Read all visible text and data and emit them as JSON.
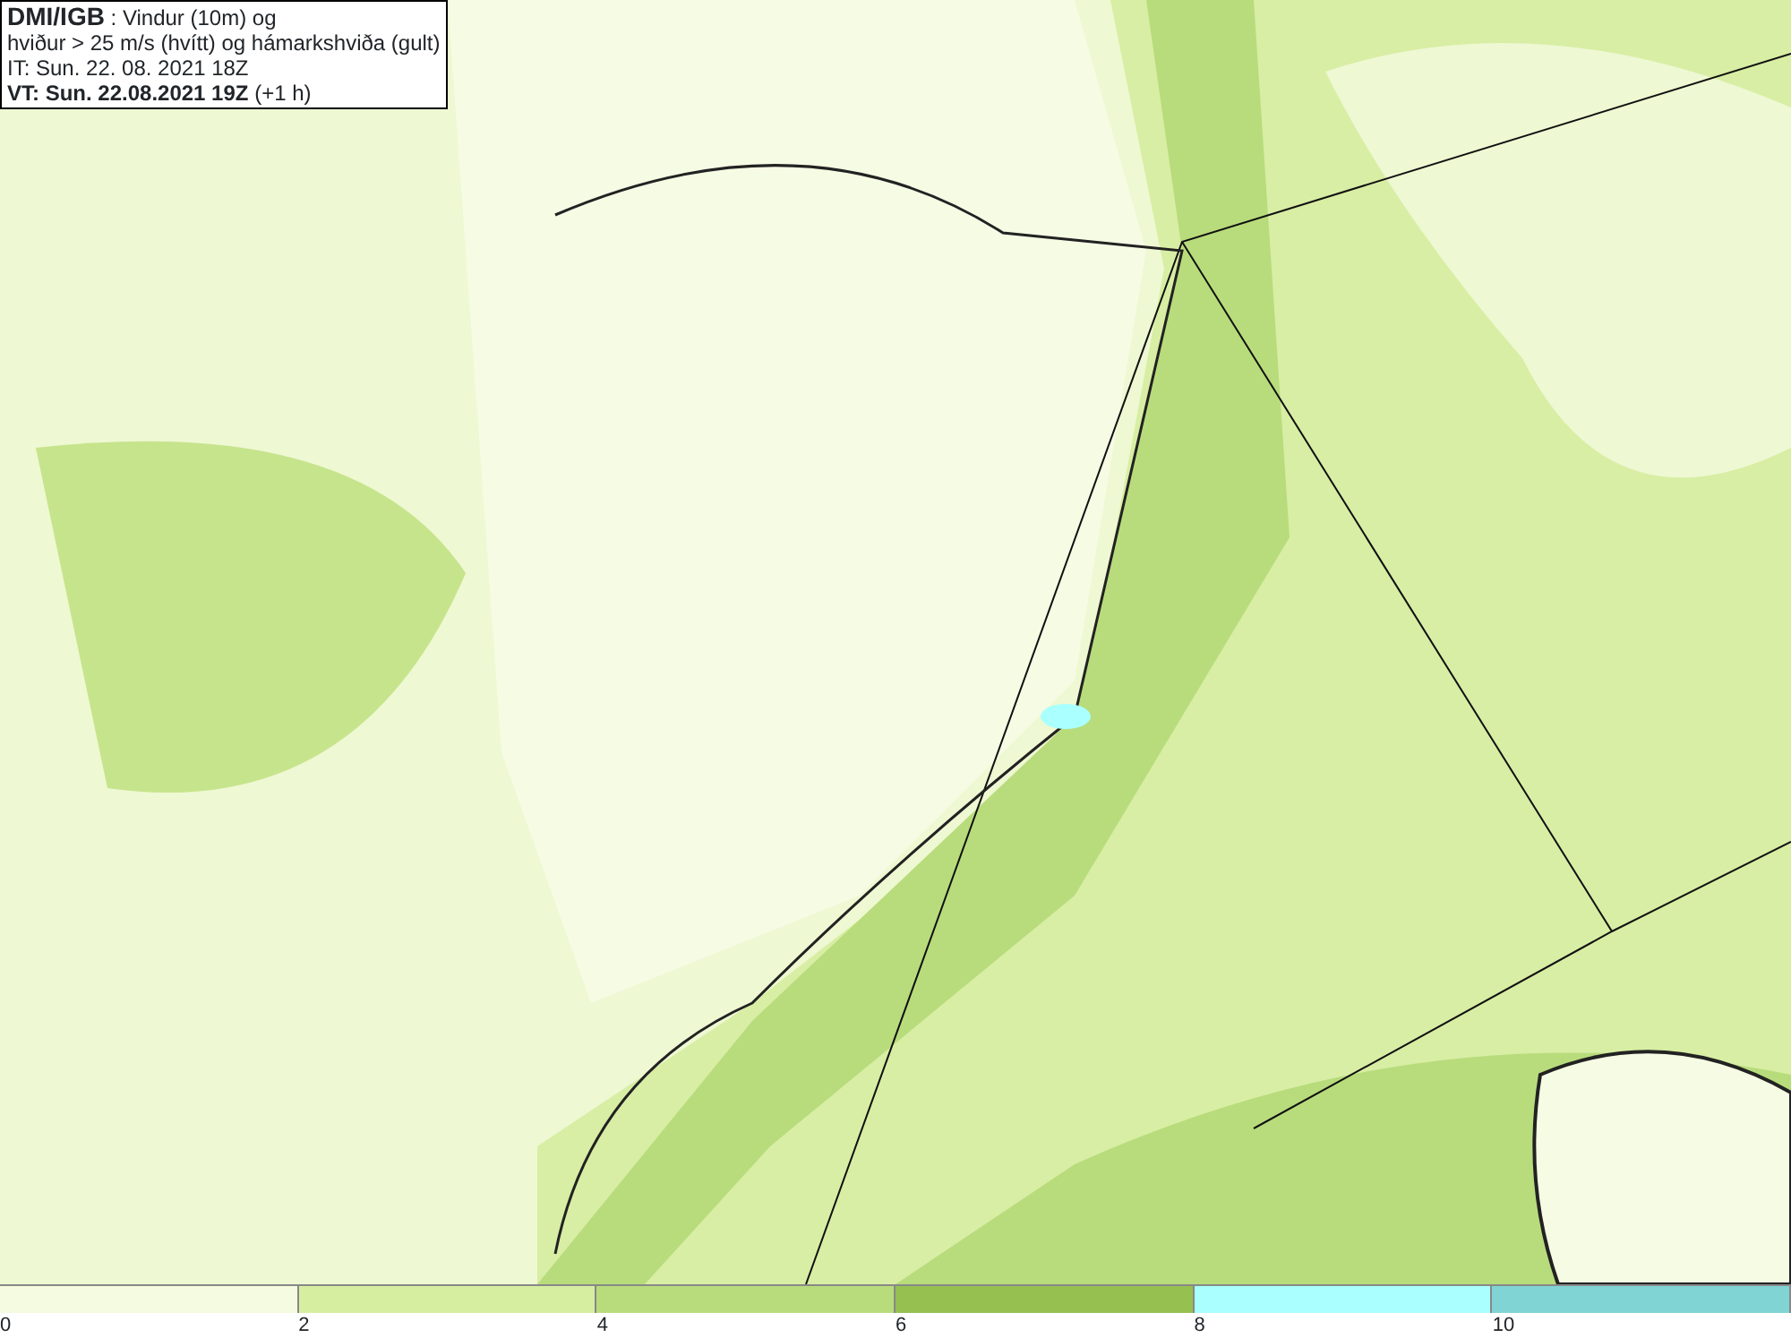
{
  "header": {
    "lines": [
      "**DMI/IGB** : Vindur (10m) og",
      "hviður > 25 m/s (hvítt) og hámarkshviða (gult)",
      "IT: Sun. 22. 08. 2021 18Z",
      "**VT: Sun. 22.08.2021 19Z** (+1 h)"
    ]
  },
  "legend": {
    "segments": [
      {
        "color": "#f4fbe0"
      },
      {
        "color": "#d6eea0"
      },
      {
        "color": "#b8dc7c"
      },
      {
        "color": "#96c050"
      },
      {
        "color": "#aaffff"
      },
      {
        "color": "#80d4d4"
      }
    ],
    "ticks": [
      "0",
      "2",
      "4",
      "6",
      "8",
      "10"
    ]
  }
}
